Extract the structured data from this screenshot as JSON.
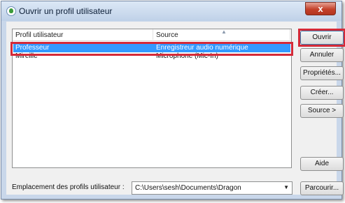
{
  "window": {
    "title": "Ouvrir un profil utilisateur",
    "close_glyph": "x",
    "icon": "dragon-app-icon"
  },
  "profile_list": {
    "columns": {
      "profile": "Profil utilisateur",
      "source": "Source"
    },
    "rows": [
      {
        "profile": "Professeur",
        "source": "Enregistreur audio numérique",
        "selected": true
      },
      {
        "profile": "Mireille",
        "source": "Microphone (Mic-In)",
        "selected": false
      }
    ]
  },
  "buttons": {
    "open": "Ouvrir",
    "cancel": "Annuler",
    "properties": "Propriétés...",
    "create": "Créer...",
    "source": "Source >",
    "help": "Aide",
    "browse": "Parcourir..."
  },
  "location": {
    "label": "Emplacement des profils utilisateur :",
    "value": "C:\\Users\\sesh\\Documents\\Dragon"
  },
  "colors": {
    "selection": "#3399ff",
    "highlight_outline": "#d42a38"
  }
}
